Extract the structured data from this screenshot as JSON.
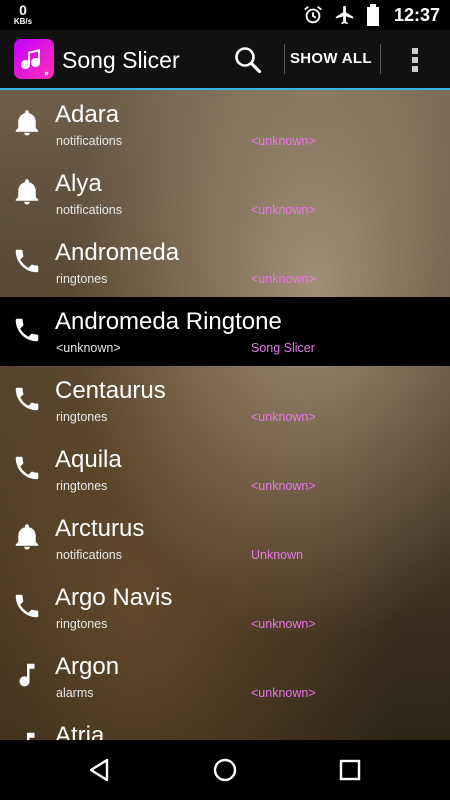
{
  "status": {
    "speed_value": "0",
    "speed_unit": "KB/s",
    "time": "12:37"
  },
  "appbar": {
    "title": "Song Slicer",
    "show_all": "SHOW ALL"
  },
  "list": [
    {
      "name": "Adara",
      "sub": "notifications",
      "artist": "<unknown>",
      "icon": "bell-icon",
      "selected": false
    },
    {
      "name": "Alya",
      "sub": "notifications",
      "artist": "<unknown>",
      "icon": "bell-icon",
      "selected": false
    },
    {
      "name": "Andromeda",
      "sub": "ringtones",
      "artist": "<unknown>",
      "icon": "phone-icon",
      "selected": false
    },
    {
      "name": "Andromeda Ringtone",
      "sub": "<unknown>",
      "artist": "Song Slicer",
      "icon": "phone-icon",
      "selected": true
    },
    {
      "name": "Centaurus",
      "sub": "ringtones",
      "artist": "<unknown>",
      "icon": "phone-icon",
      "selected": false
    },
    {
      "name": "Aquila",
      "sub": "ringtones",
      "artist": "<unknown>",
      "icon": "phone-icon",
      "selected": false
    },
    {
      "name": "Arcturus",
      "sub": "notifications",
      "artist": "Unknown",
      "icon": "bell-icon",
      "selected": false
    },
    {
      "name": "Argo Navis",
      "sub": "ringtones",
      "artist": "<unknown>",
      "icon": "phone-icon",
      "selected": false
    },
    {
      "name": "Argon",
      "sub": "alarms",
      "artist": "<unknown>",
      "icon": "music-note-icon",
      "selected": false
    },
    {
      "name": "Atria",
      "sub": "",
      "artist": "",
      "icon": "music-note-icon",
      "selected": false
    }
  ],
  "colors": {
    "accent": "#33b5e5",
    "artist_text": "#e879e6",
    "logo": "#e020d0"
  }
}
